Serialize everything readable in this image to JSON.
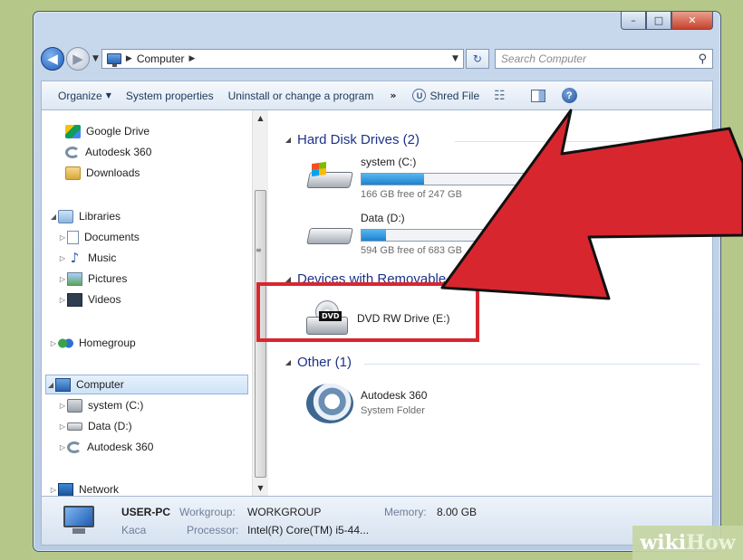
{
  "window": {
    "min_glyph": "–",
    "max_glyph": "□",
    "close_glyph": "✕"
  },
  "address": {
    "crumbs": [
      "Computer"
    ],
    "search_placeholder": "Search Computer"
  },
  "toolbar": {
    "organize": "Organize",
    "system_properties": "System properties",
    "uninstall": "Uninstall or change a program",
    "more": "»",
    "shred_icon_text": "U",
    "shred": "Shred File"
  },
  "nav": {
    "favorites": [
      {
        "label": "Google Drive",
        "icon": "google-drive-icon"
      },
      {
        "label": "Autodesk 360",
        "icon": "autodesk-360-icon"
      },
      {
        "label": "Downloads",
        "icon": "downloads-folder-icon"
      }
    ],
    "libraries": {
      "label": "Libraries",
      "items": [
        "Documents",
        "Music",
        "Pictures",
        "Videos"
      ]
    },
    "homegroup": "Homegroup",
    "computer": {
      "label": "Computer",
      "items": [
        "system (C:)",
        "Data (D:)",
        "Autodesk 360"
      ]
    },
    "network": "Network"
  },
  "content": {
    "groups": {
      "hard_disk": "Hard Disk Drives (2)",
      "removable": "Devices with Removable St",
      "other": "Other (1)"
    },
    "drives": [
      {
        "name": "system (C:)",
        "free": "166 GB free of 247 GB",
        "used_fraction": 0.33,
        "icon": "windows-drive-icon"
      },
      {
        "name": "Data (D:)",
        "free": "594 GB free of 683 GB",
        "used_fraction": 0.13,
        "icon": "hard-drive-icon"
      }
    ],
    "dvd": {
      "name": "DVD RW Drive (E:)",
      "badge": "DVD"
    },
    "other": {
      "name": "Autodesk 360",
      "type": "System Folder"
    }
  },
  "status": {
    "computer_name": "USER-PC",
    "user": "Kaca",
    "workgroup_label": "Workgroup:",
    "workgroup": "WORKGROUP",
    "memory_label": "Memory:",
    "memory": "8.00 GB",
    "processor_label": "Processor:",
    "processor": "Intel(R) Core(TM) i5-44..."
  },
  "watermark": {
    "a": "wiki",
    "b": "How"
  },
  "colors": {
    "highlight": "#d8262f",
    "arrow": "#d8262f",
    "bar_fill": "#1f82cf"
  }
}
